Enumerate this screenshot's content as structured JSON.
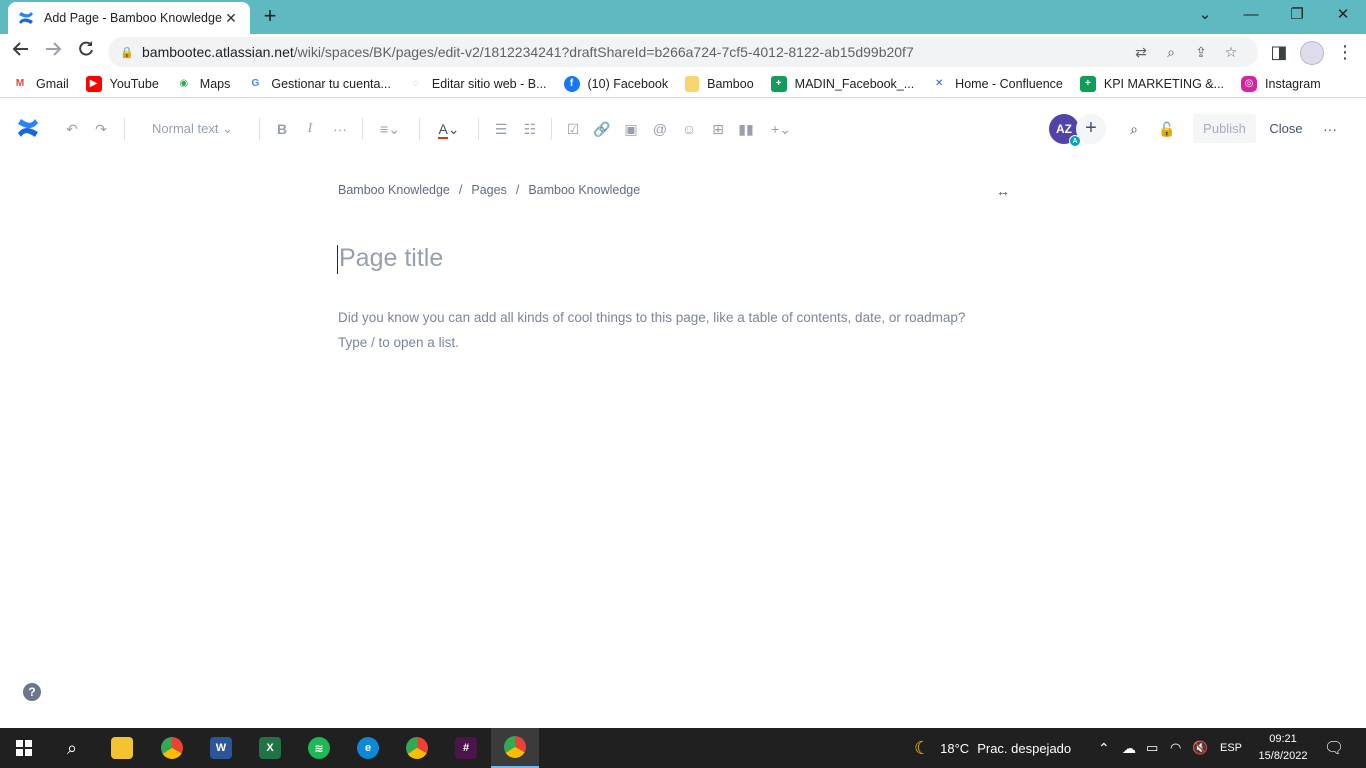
{
  "browser": {
    "tab_title": "Add Page - Bamboo Knowledge",
    "tab_close": "✕",
    "new_tab": "+",
    "url_host": "bambootec.atlassian.net",
    "url_path": "/wiki/spaces/BK/pages/edit-v2/1812234241?draftShareId=b266a724-7cf5-4012-8122-ab15d99b20f7",
    "window_controls": [
      "⌄",
      "—",
      "❐",
      "✕"
    ]
  },
  "bookmarks": [
    {
      "label": "Gmail",
      "icon": "gmail-icon",
      "color": "#ea4335",
      "glyph": "M"
    },
    {
      "label": "YouTube",
      "icon": "youtube-icon",
      "color": "#ff0000",
      "glyph": "▶"
    },
    {
      "label": "Maps",
      "icon": "maps-icon",
      "color": "#34a853",
      "glyph": "◉"
    },
    {
      "label": "Gestionar tu cuenta...",
      "icon": "google-icon",
      "color": "#4285f4",
      "glyph": "G"
    },
    {
      "label": "Editar sitio web - B...",
      "icon": "site-icon",
      "color": "#5fb9c1",
      "glyph": "◌"
    },
    {
      "label": "(10) Facebook",
      "icon": "facebook-icon",
      "color": "#1877f2",
      "glyph": "f"
    },
    {
      "label": "Bamboo",
      "icon": "folder-icon",
      "color": "#f9d56e",
      "glyph": ""
    },
    {
      "label": "MADIN_Facebook_...",
      "icon": "sheets-icon",
      "color": "#0f9d58",
      "glyph": "+"
    },
    {
      "label": "Home - Confluence",
      "icon": "confluence-icon",
      "color": "#1868db",
      "glyph": "✕"
    },
    {
      "label": "KPI MARKETING &...",
      "icon": "sheets-icon",
      "color": "#0f9d58",
      "glyph": "+"
    },
    {
      "label": "Instagram",
      "icon": "instagram-icon",
      "color": "#d6249f",
      "glyph": "◎"
    }
  ],
  "toolbar": {
    "text_style": "Normal text",
    "avatar_initials": "AZ",
    "avatar_badge": "A",
    "publish_label": "Publish",
    "close_label": "Close",
    "more_label": "···"
  },
  "editor": {
    "breadcrumbs": [
      "Bamboo Knowledge",
      "Pages",
      "Bamboo Knowledge"
    ],
    "breadcrumb_sep": "/",
    "title_placeholder": "Page title",
    "hint_line1": "Did you know you can add all kinds of cool things to this page, like a table of contents, date, or roadmap?",
    "hint_line2": "Type / to open a list.",
    "help": "?"
  },
  "taskbar": {
    "weather_temp": "18°C",
    "weather_text": "Prac. despejado",
    "lang": "ESP",
    "time": "09:21",
    "date": "15/8/2022"
  }
}
